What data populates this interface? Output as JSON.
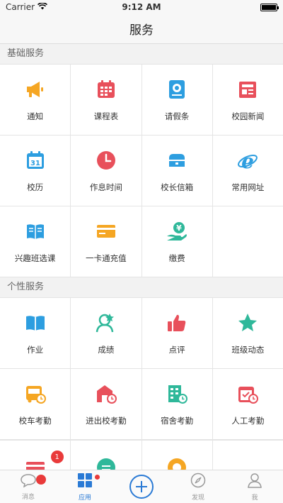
{
  "status": {
    "carrier": "Carrier",
    "time": "9:12 AM"
  },
  "nav": {
    "title": "服务"
  },
  "sections": [
    {
      "title": "基础服务",
      "items": [
        {
          "label": "通知",
          "icon": "megaphone-icon",
          "color": "#f5a623"
        },
        {
          "label": "课程表",
          "icon": "calendar-grid-icon",
          "color": "#e8505b"
        },
        {
          "label": "请假条",
          "icon": "leave-slip-icon",
          "color": "#2d9ee0"
        },
        {
          "label": "校园新闻",
          "icon": "newspaper-icon",
          "color": "#e8505b"
        },
        {
          "label": "校历",
          "icon": "calendar-31-icon",
          "color": "#2d9ee0"
        },
        {
          "label": "作息时间",
          "icon": "clock-icon",
          "color": "#e8505b"
        },
        {
          "label": "校长信箱",
          "icon": "mailbox-icon",
          "color": "#2d9ee0"
        },
        {
          "label": "常用网址",
          "icon": "browser-e-icon",
          "color": "#2d9ee0"
        },
        {
          "label": "兴趣班选课",
          "icon": "open-book-icon",
          "color": "#2d9ee0"
        },
        {
          "label": "一卡通充值",
          "icon": "card-icon",
          "color": "#f5a623"
        },
        {
          "label": "缴费",
          "icon": "yen-hand-icon",
          "color": "#2fb89a"
        }
      ]
    },
    {
      "title": "个性服务",
      "items": [
        {
          "label": "作业",
          "icon": "book-icon",
          "color": "#2d9ee0"
        },
        {
          "label": "成绩",
          "icon": "grade-person-icon",
          "color": "#2fb89a"
        },
        {
          "label": "点评",
          "icon": "thumbs-up-icon",
          "color": "#e8505b"
        },
        {
          "label": "班级动态",
          "icon": "star-icon",
          "color": "#2fb89a"
        },
        {
          "label": "校车考勤",
          "icon": "bus-clock-icon",
          "color": "#f5a623"
        },
        {
          "label": "进出校考勤",
          "icon": "gate-clock-icon",
          "color": "#e8505b"
        },
        {
          "label": "宿舍考勤",
          "icon": "building-clock-icon",
          "color": "#2fb89a"
        },
        {
          "label": "人工考勤",
          "icon": "calendar-check-icon",
          "color": "#e8505b"
        },
        {
          "label": "",
          "icon": "card-partial-icon",
          "color": "#e8505b",
          "badge": "1"
        },
        {
          "label": "",
          "icon": "chat-partial-icon",
          "color": "#2fb89a"
        },
        {
          "label": "",
          "icon": "clock-partial-icon",
          "color": "#f5a623"
        }
      ]
    }
  ],
  "tabs": [
    {
      "label": "消息",
      "icon": "chat-bubble-icon"
    },
    {
      "label": "应用",
      "icon": "grid-icon"
    },
    {
      "label": "",
      "icon": "plus-circle-icon"
    },
    {
      "label": "发现",
      "icon": "compass-icon"
    },
    {
      "label": "我",
      "icon": "person-icon"
    }
  ],
  "colors": {
    "accent": "#2a7ad5",
    "badge": "#e93a3a"
  }
}
